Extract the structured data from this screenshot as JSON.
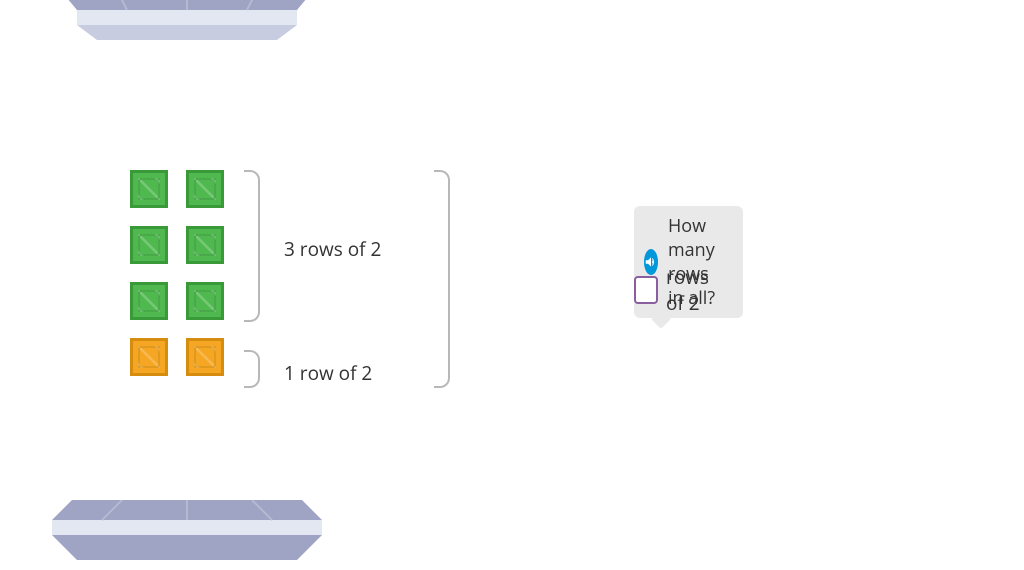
{
  "tiles": {
    "green_rows": 3,
    "orange_rows": 1,
    "cols": 2
  },
  "labels": {
    "group1": "3 rows of 2",
    "group2": "1 row of 2"
  },
  "prompt": {
    "question": "How many rows in all?",
    "answer_suffix": "rows of 2",
    "input_value": ""
  },
  "icons": {
    "speaker": "speaker-icon"
  },
  "colors": {
    "green": "#4fb94f",
    "orange": "#f5a623",
    "tray": "#9fa3c4",
    "tray_light": "#e3e7f2",
    "input_border": "#8b5e9e",
    "speaker_bg": "#0098db"
  }
}
